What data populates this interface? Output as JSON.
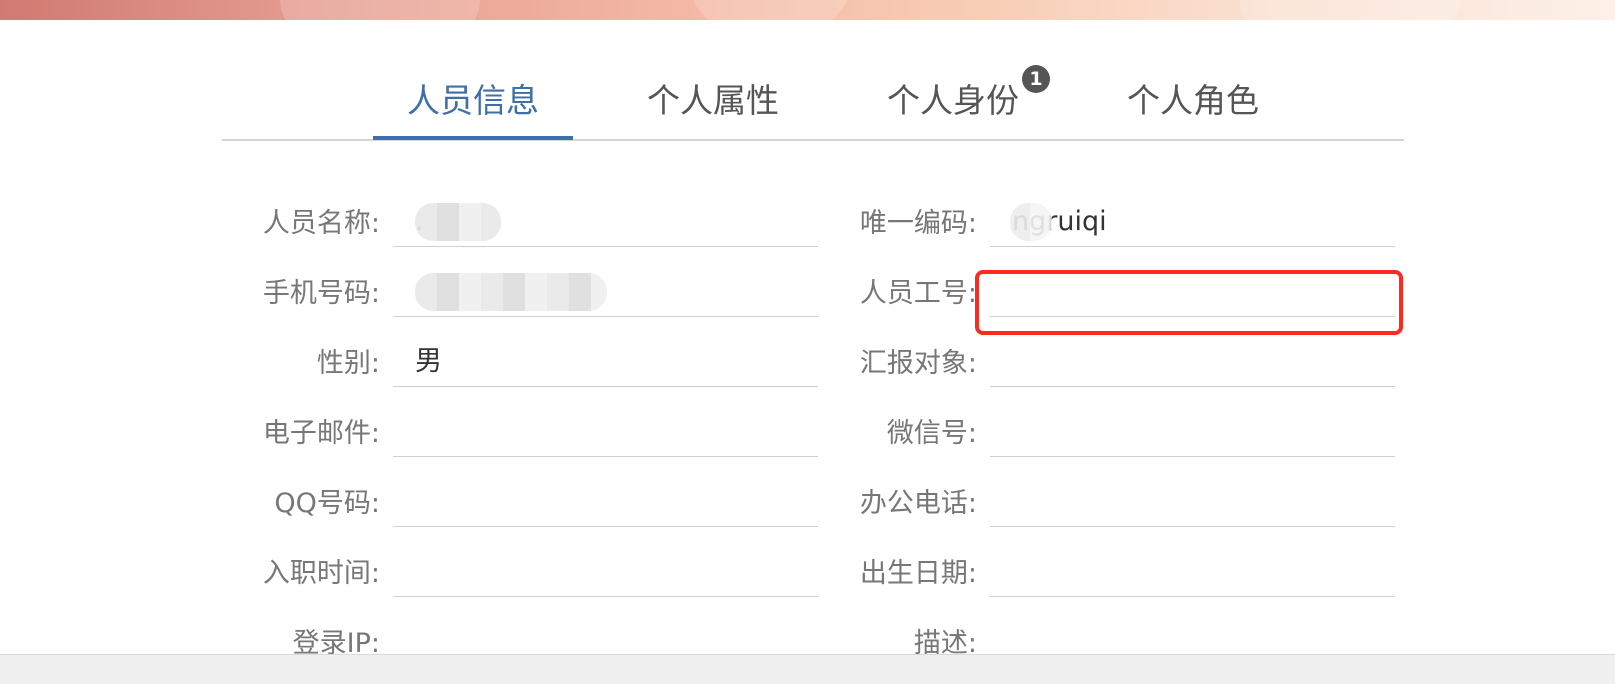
{
  "tabs": [
    {
      "label": "人员信息",
      "active": true
    },
    {
      "label": "个人属性",
      "active": false
    },
    {
      "label": "个人身份",
      "active": false,
      "badge": "1"
    },
    {
      "label": "个人角色",
      "active": false
    }
  ],
  "form": {
    "left": [
      {
        "label": "人员名称:",
        "value": "."
      },
      {
        "label": "手机号码:",
        "value": ""
      },
      {
        "label": "性别:",
        "value": "男"
      },
      {
        "label": "电子邮件:",
        "value": ""
      },
      {
        "label": "QQ号码:",
        "value": ""
      },
      {
        "label": "入职时间:",
        "value": ""
      },
      {
        "label": "登录IP:",
        "value": ""
      }
    ],
    "right": [
      {
        "label": "唯一编码:",
        "value": "ngruiqi"
      },
      {
        "label": "人员工号:",
        "value": ""
      },
      {
        "label": "汇报对象:",
        "value": ""
      },
      {
        "label": "微信号:",
        "value": ""
      },
      {
        "label": "办公电话:",
        "value": ""
      },
      {
        "label": "出生日期:",
        "value": ""
      },
      {
        "label": "描述:",
        "value": ""
      }
    ]
  },
  "colors": {
    "accent": "#3f6ea8",
    "highlight": "#ff2a1f",
    "label": "#777777"
  }
}
